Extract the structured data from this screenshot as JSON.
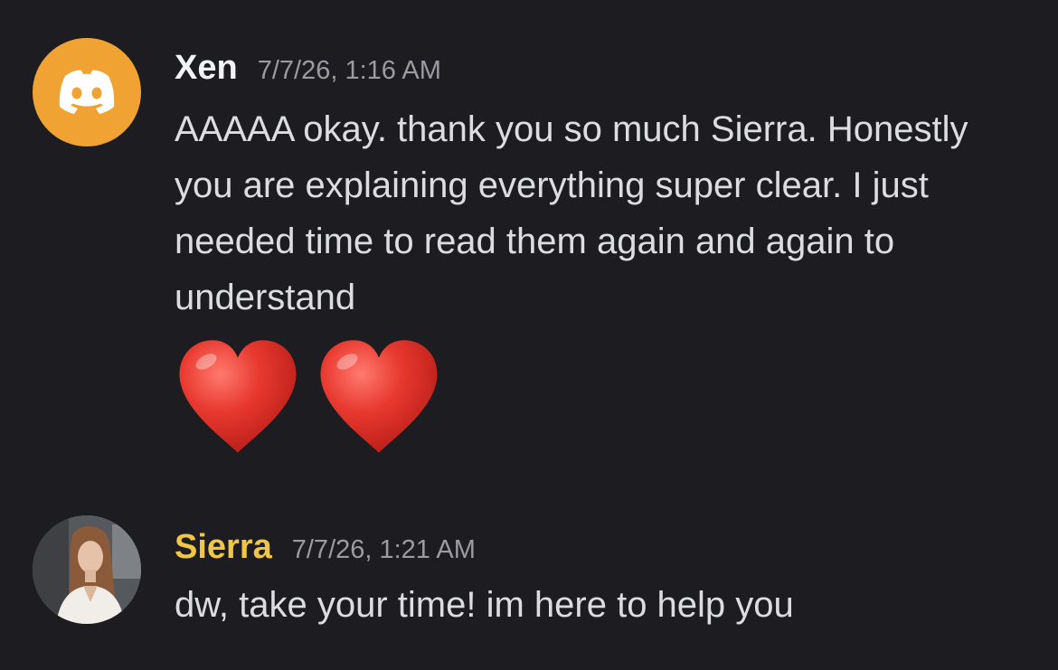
{
  "messages": [
    {
      "username": "Xen",
      "timestamp": "7/7/26, 1:16 AM",
      "text": "AAAAA okay. thank you so much Sierra. Honestly you are explaining everything super clear. I just needed time to read them again and again to understand",
      "emoji": [
        "❤️",
        "❤️"
      ],
      "avatar": "discord-logo-icon",
      "avatar_color": "#f0a232",
      "name_color": "#f2f3f5"
    },
    {
      "username": "Sierra",
      "timestamp": "7/7/26, 1:21 AM",
      "text": "dw, take your time! im here to help you",
      "avatar": "user-photo",
      "name_color": "#f0c646"
    }
  ],
  "colors": {
    "background": "#1c1c21",
    "message_text": "#dcdde1",
    "timestamp": "#9a9ba3",
    "heart": "#e0312b"
  }
}
